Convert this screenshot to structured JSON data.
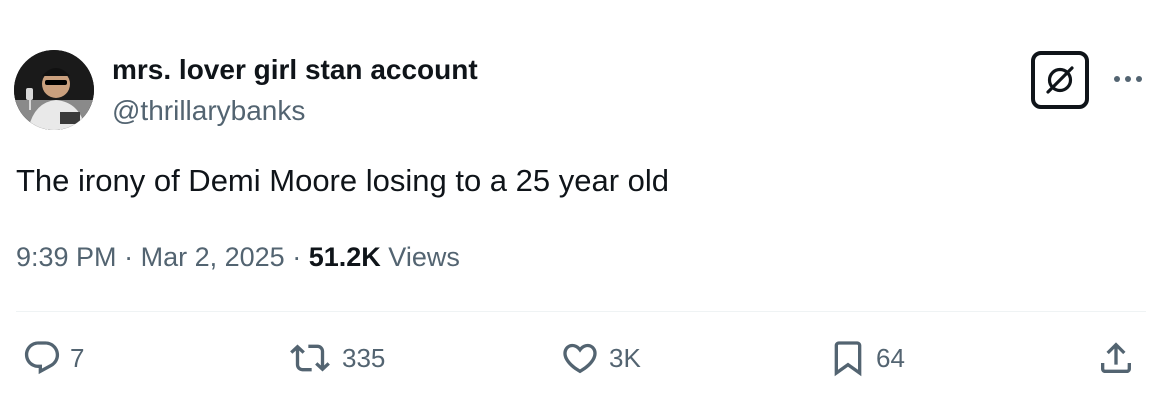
{
  "tweet": {
    "author": {
      "display_name": "mrs. lover girl stan account",
      "handle": "@thrillarybanks"
    },
    "text": "The irony of Demi Moore losing to a 25 year old",
    "time": "9:39 PM",
    "separator": "·",
    "date": "Mar 2, 2025",
    "views_count": "51.2K",
    "views_label": "Views"
  },
  "actions": {
    "reply_count": "7",
    "retweet_count": "335",
    "like_count": "3K",
    "bookmark_count": "64"
  },
  "icons": [
    "grok-icon",
    "more-icon",
    "reply-icon",
    "retweet-icon",
    "like-icon",
    "bookmark-icon",
    "share-icon"
  ],
  "colors": {
    "text": "#0f1419",
    "secondary": "#536471",
    "divider": "#eff3f4"
  }
}
